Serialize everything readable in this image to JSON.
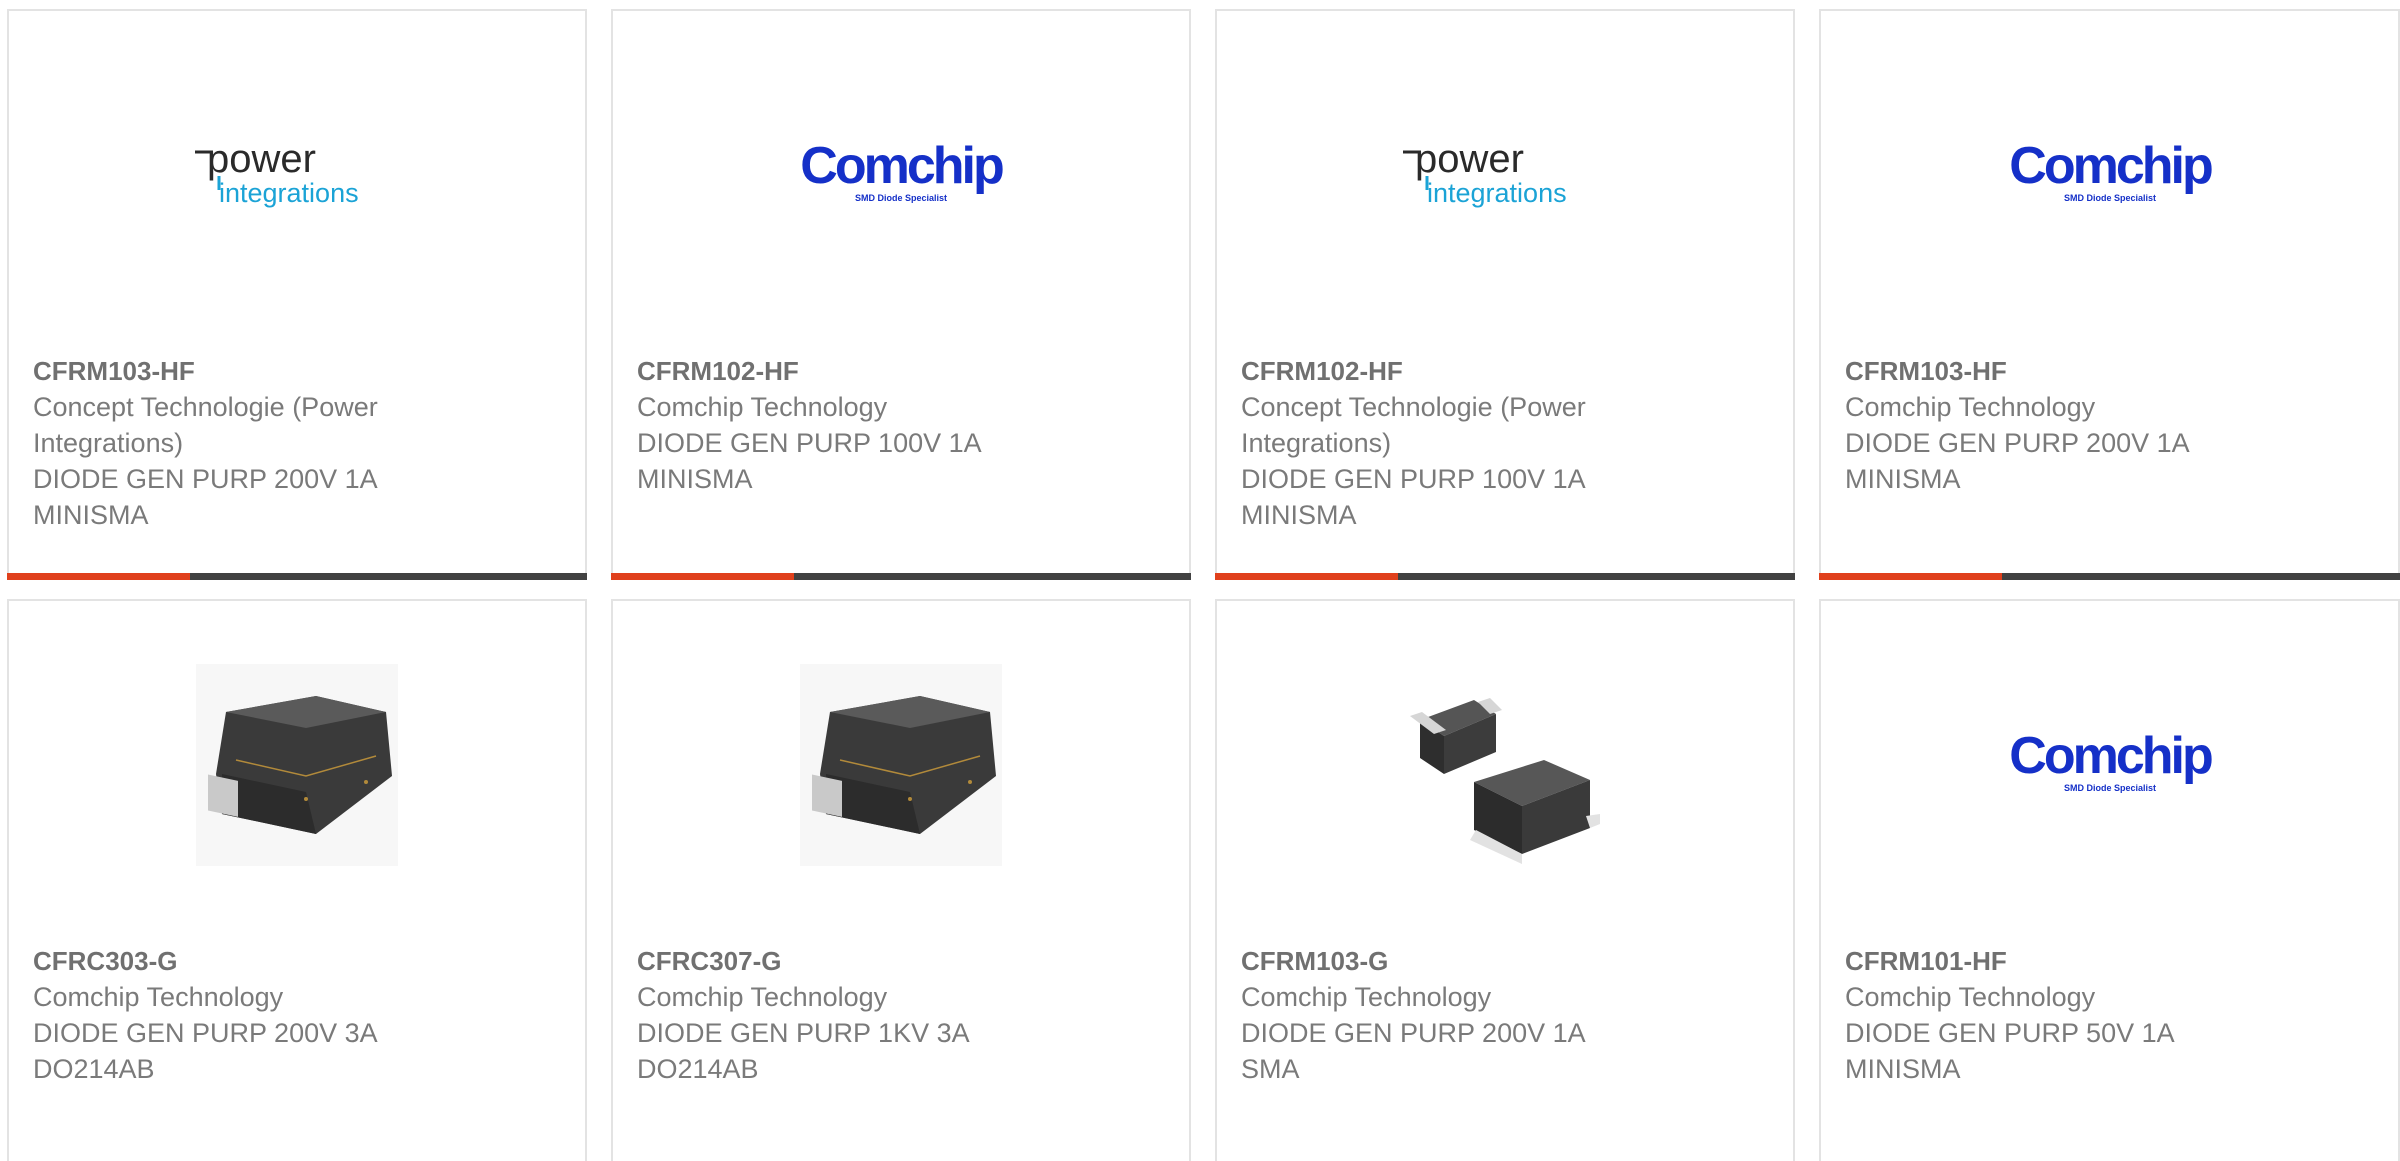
{
  "products": [
    {
      "part_number": "CFRM103-HF",
      "manufacturer": "Concept Technologie (Power Integrations)",
      "description": "DIODE GEN PURP 200V 1A MINISMA",
      "image": "power-integrations-logo",
      "logo_text": {
        "main": "power",
        "sub": "integrations"
      }
    },
    {
      "part_number": "CFRM102-HF",
      "manufacturer": "Comchip Technology",
      "description": "DIODE GEN PURP 100V 1A MINISMA",
      "image": "comchip-logo",
      "logo_text": {
        "main": "Comchip",
        "sub": "SMD Diode Specialist"
      }
    },
    {
      "part_number": "CFRM102-HF",
      "manufacturer": "Concept Technologie (Power Integrations)",
      "description": "DIODE GEN PURP 100V 1A MINISMA",
      "image": "power-integrations-logo",
      "logo_text": {
        "main": "power",
        "sub": "integrations"
      }
    },
    {
      "part_number": "CFRM103-HF",
      "manufacturer": "Comchip Technology",
      "description": "DIODE GEN PURP 200V 1A MINISMA",
      "image": "comchip-logo",
      "logo_text": {
        "main": "Comchip",
        "sub": "SMD Diode Specialist"
      }
    },
    {
      "part_number": "CFRC303-G",
      "manufacturer": "Comchip Technology",
      "description": "DIODE GEN PURP 200V 3A DO214AB",
      "image": "do214ab-package-photo"
    },
    {
      "part_number": "CFRC307-G",
      "manufacturer": "Comchip Technology",
      "description": "DIODE GEN PURP 1KV 3A DO214AB",
      "image": "do214ab-package-photo"
    },
    {
      "part_number": "CFRM103-G",
      "manufacturer": "Comchip Technology",
      "description": "DIODE GEN PURP 200V 1A SMA",
      "image": "sma-package-photo"
    },
    {
      "part_number": "CFRM101-HF",
      "manufacturer": "Comchip Technology",
      "description": "DIODE GEN PURP 50V 1A MINISMA",
      "image": "comchip-logo",
      "logo_text": {
        "main": "Comchip",
        "sub": "SMD Diode Specialist"
      }
    }
  ],
  "colors": {
    "accent": "#e0401c",
    "bar": "#414141",
    "border": "#e3e3e3",
    "text": "#7a7a7a",
    "power_logo": "#2a2a2a",
    "integrations_blue": "#1ba3d6",
    "comchip_blue": "#1530c8"
  }
}
